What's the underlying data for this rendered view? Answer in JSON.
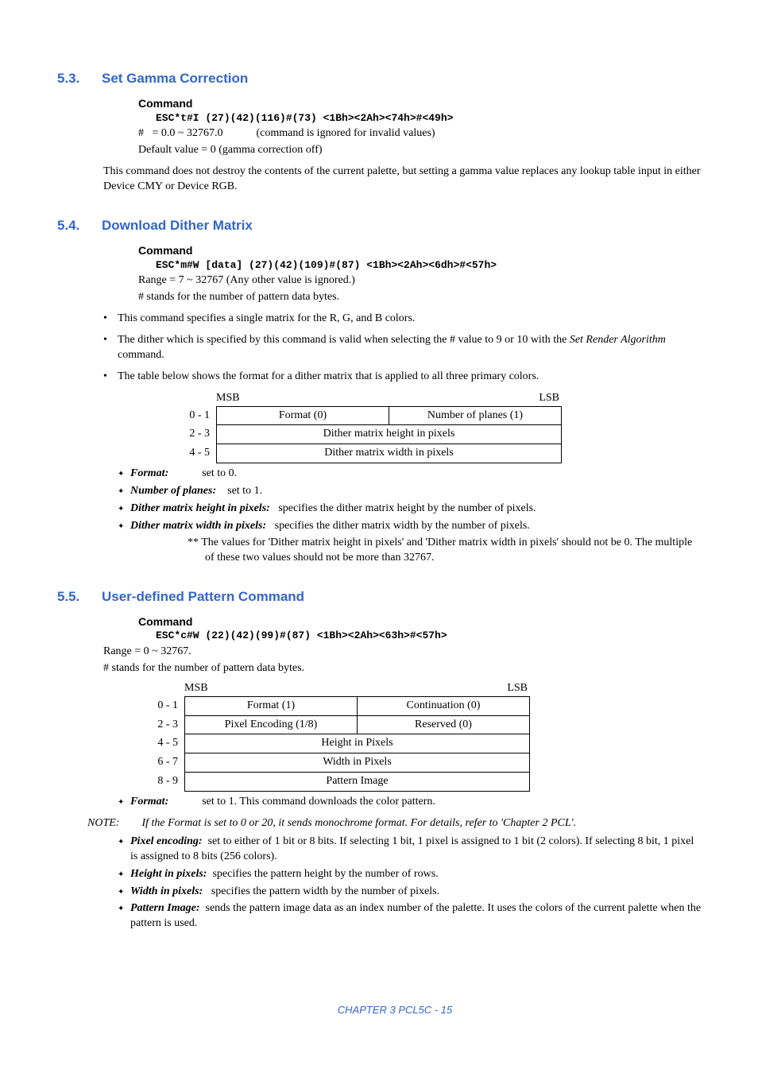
{
  "s53": {
    "num": "5.3.",
    "title": "Set Gamma Correction",
    "command_label": "Command",
    "code": "ESC*t#I (27)(42)(116)#(73)   <1Bh><2Ah><74h>#<49h>",
    "hash_line_prefix": "#   = 0.0 ~ 32767.0            (command is ignored for invalid values)",
    "default_line": "Default value = 0 (gamma correction off)",
    "para": "This command does not destroy the contents of the current palette, but setting a gamma value replaces any lookup table input in either Device CMY or Device RGB."
  },
  "s54": {
    "num": "5.4.",
    "title": "Download Dither Matrix",
    "command_label": "Command",
    "code": "ESC*m#W [data] (27)(42)(109)#(87)   <1Bh><2Ah><6dh>#<57h>",
    "range_line": "Range = 7 ~ 32767 (Any other value is ignored.)",
    "stands_line": "# stands for the number of pattern data bytes.",
    "bullet1": "This command specifies a single matrix for the R, G, and B colors.",
    "bullet2_before": "The dither which is specified by this command is valid when selecting the # value to 9 or 10 with the ",
    "bullet2_ital": "Set Render Algorithm",
    "bullet2_after": " command.",
    "bullet3": "The table below shows the format for a dither matrix that is applied to all three primary colors.",
    "msb": "MSB",
    "lsb": "LSB",
    "rows": [
      "0 - 1",
      "2 - 3",
      "4 - 5"
    ],
    "cells_r0": [
      "Format (0)",
      "Number of planes (1)"
    ],
    "cells_r1": "Dither matrix height in pixels",
    "cells_r2": "Dither matrix width in pixels",
    "sub1_label": "Format:",
    "sub1_rest": "set to 0.",
    "sub2_label": "Number of planes:",
    "sub2_rest": "set to 1.",
    "sub3_label": "Dither matrix height in pixels:",
    "sub3_rest": "specifies the dither matrix height by the number of pixels.",
    "sub4_label": "Dither matrix width in pixels:",
    "sub4_rest": "specifies the dither matrix width by the number of pixels.",
    "stars": "**  The values for 'Dither matrix height in pixels' and 'Dither matrix width in pixels' should not be 0. The multiple of these two values should not be more than 32767."
  },
  "s55": {
    "num": "5.5.",
    "title": "User-defined Pattern Command",
    "command_label": "Command",
    "code": "ESC*c#W (22)(42)(99)#(87)   <1Bh><2Ah><63h>#<57h>",
    "range_line": "Range = 0 ~ 32767.",
    "stands_line": "# stands for the number of pattern data bytes.",
    "msb": "MSB",
    "lsb": "LSB",
    "rows": [
      "0 - 1",
      "2 - 3",
      "4 - 5",
      "6 - 7",
      "8 - 9"
    ],
    "r0": [
      "Format (1)",
      "Continuation (0)"
    ],
    "r1": [
      "Pixel Encoding (1/8)",
      "Reserved (0)"
    ],
    "r2": "Height in Pixels",
    "r3": "Width in Pixels",
    "r4": "Pattern Image",
    "sub1_label": "Format:",
    "sub1_rest": "set to 1.    This command downloads the color pattern.",
    "note_label": "NOTE:",
    "note_text": "If the Format is set to 0 or 20, it sends monochrome format.    For details, refer to 'Chapter 2 PCL'.",
    "sub2_label": "Pixel encoding:",
    "sub2_rest": "set to either of 1 bit or 8 bits.    If selecting 1 bit, 1 pixel is assigned to 1 bit (2 colors).  If selecting 8 bit, 1 pixel is assigned to 8 bits (256 colors).",
    "sub3_label": "Height in pixels:",
    "sub3_rest": "specifies the pattern height by the number of rows.",
    "sub4_label": "Width in pixels:",
    "sub4_rest": "specifies the pattern width by the number of pixels.",
    "sub5_label": "Pattern Image:",
    "sub5_rest": "sends the pattern image data as an index number of the palette.    It uses the colors of the current palette when the pattern is used."
  },
  "footer": "CHAPTER 3 PCL5C - 15"
}
